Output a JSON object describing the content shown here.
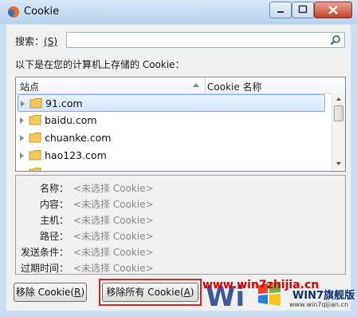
{
  "window": {
    "title": "Cookie"
  },
  "search": {
    "label": "搜索：",
    "accel": "(S)",
    "value": ""
  },
  "intro": "以下是在您的计算机上存储的 Cookie：",
  "tree": {
    "columns": [
      "站点",
      "Cookie 名称"
    ],
    "rows": [
      {
        "site": "91.com",
        "selected": true
      },
      {
        "site": "baidu.com",
        "selected": false
      },
      {
        "site": "chuanke.com",
        "selected": false
      },
      {
        "site": "hao123.com",
        "selected": false
      }
    ]
  },
  "details": [
    {
      "key": "名称：",
      "value": "<未选择 Cookie>"
    },
    {
      "key": "内容：",
      "value": "<未选择 Cookie>"
    },
    {
      "key": "主机：",
      "value": "<未选择 Cookie>"
    },
    {
      "key": "路径：",
      "value": "<未选择 Cookie>"
    },
    {
      "key": "发送条件：",
      "value": "<未选择 Cookie>"
    },
    {
      "key": "过期时间：",
      "value": "<未选择 Cookie>"
    }
  ],
  "buttons": {
    "remove_prefix": "移除 Cookie(",
    "remove_accel": "R",
    "remove_suffix": ")",
    "remove_all_prefix": "移除所有 Cookie(",
    "remove_all_accel": "A",
    "remove_all_suffix": ")"
  },
  "watermark": {
    "url": "www.win7zhijia.cn",
    "brand": "WIN7旗舰版",
    "sub": "www.win7qijian.cn"
  },
  "colors": {
    "titlebar": "#c6dcf2",
    "highlight_box": "#d42a2a",
    "watermark_red": "#d60000"
  }
}
